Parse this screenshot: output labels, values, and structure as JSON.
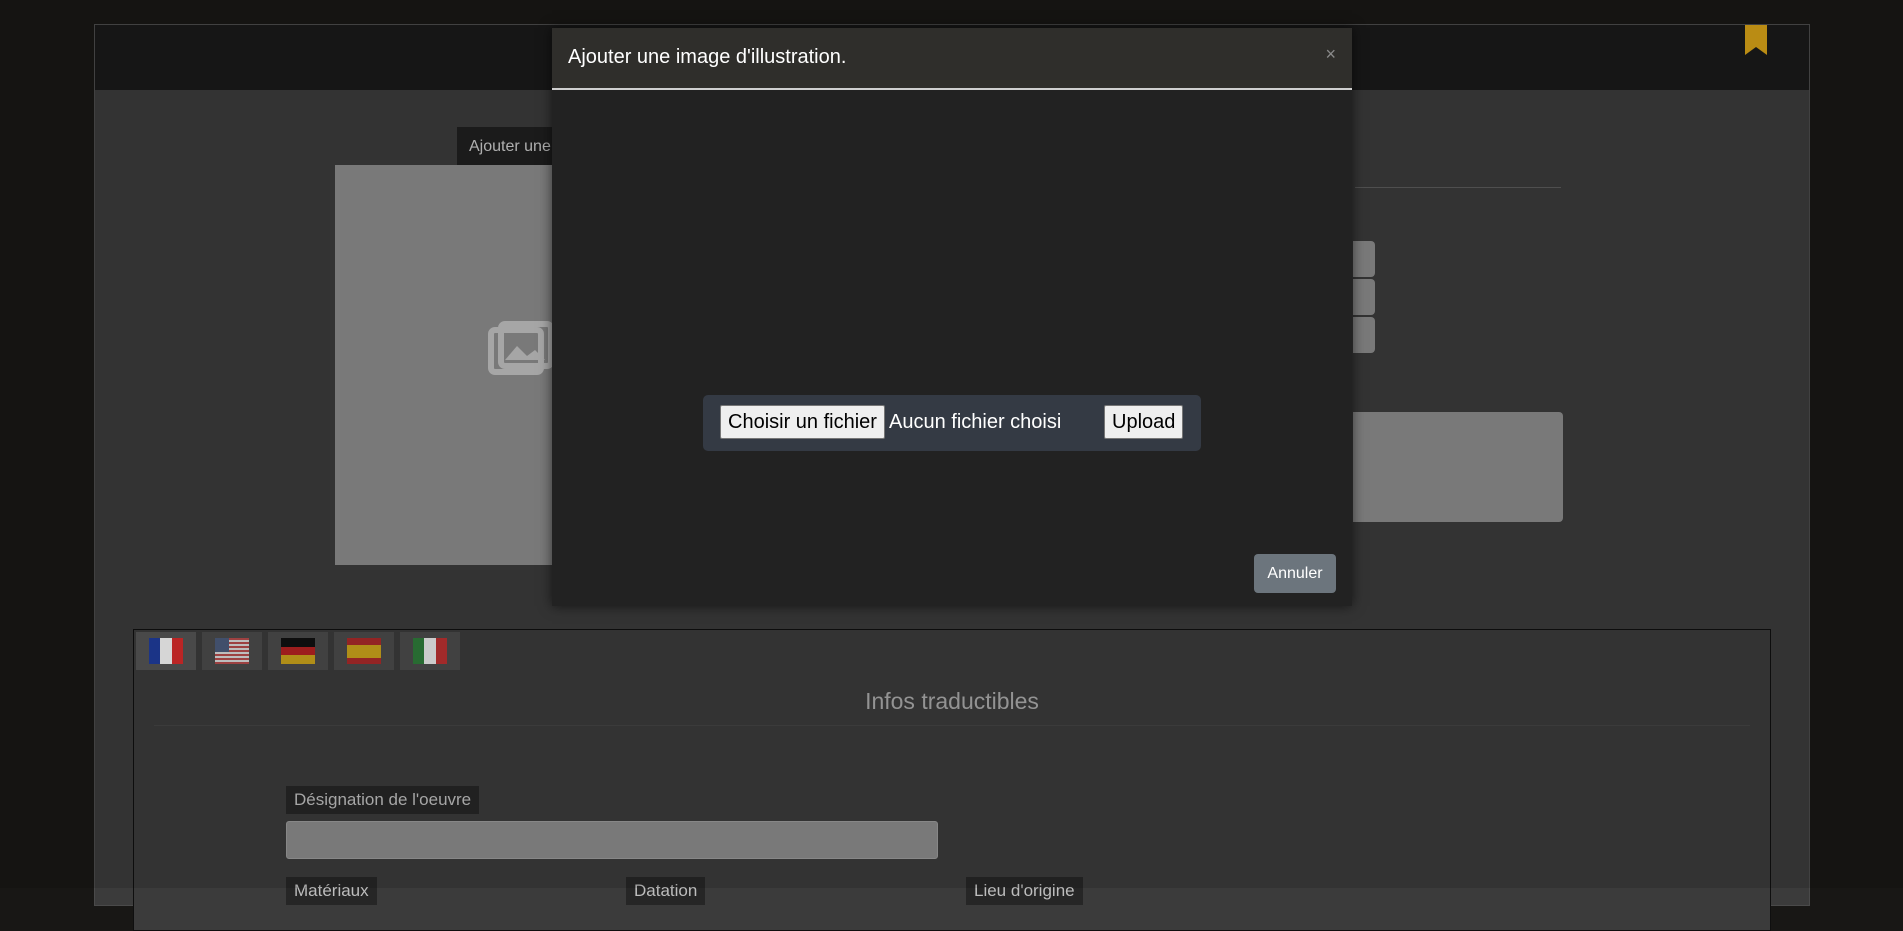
{
  "background_page": {
    "tooltip_tab_label": "Ajouter une image",
    "translatable_section": {
      "title": "Infos traductibles",
      "flags": [
        {
          "name": "fr"
        },
        {
          "name": "us"
        },
        {
          "name": "de"
        },
        {
          "name": "es"
        },
        {
          "name": "it"
        }
      ],
      "fields": {
        "designation_label": "Désignation de l'oeuvre",
        "materials_label": "Matériaux",
        "dating_label": "Datation",
        "origin_label": "Lieu d'origine"
      }
    },
    "bookmark_color": "#d4a017"
  },
  "modal": {
    "title": "Ajouter une image d'illustration.",
    "close_symbol": "×",
    "file_input": {
      "choose_label": "Choisir un fichier",
      "no_file_text": "Aucun fichier choisi"
    },
    "upload_label": "Upload",
    "cancel_label": "Annuler",
    "cancel_color": "#6c757d"
  }
}
